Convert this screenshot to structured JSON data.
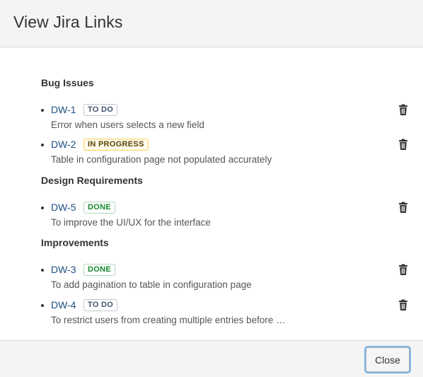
{
  "dialog": {
    "title": "View Jira Links"
  },
  "sections": [
    {
      "title": "Bug Issues",
      "items": [
        {
          "key": "DW-1",
          "status": "TO DO",
          "summary": "Error when users selects a new field"
        },
        {
          "key": "DW-2",
          "status": "IN PROGRESS",
          "summary": "Table in configuration page not populated accurately"
        }
      ]
    },
    {
      "title": "Design Requirements",
      "items": [
        {
          "key": "DW-5",
          "status": "DONE",
          "summary": "To improve the UI/UX for the interface"
        }
      ]
    },
    {
      "title": "Improvements",
      "items": [
        {
          "key": "DW-3",
          "status": "DONE",
          "summary": "To add pagination to table in configuration page"
        },
        {
          "key": "DW-4",
          "status": "TO DO",
          "summary": "To restrict users from creating multiple entries before …"
        }
      ]
    }
  ],
  "footer": {
    "close_label": "Close"
  },
  "colors": {
    "link": "#205081",
    "todo": "#42526e",
    "in_progress": "#594300",
    "done": "#14892c"
  },
  "icons": {
    "delete": "trash-icon"
  }
}
